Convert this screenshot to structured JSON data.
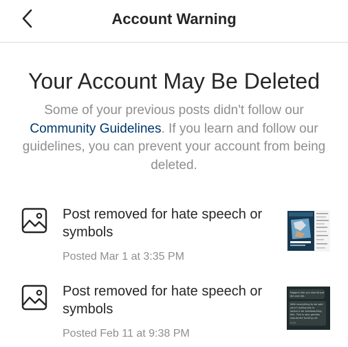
{
  "header": {
    "title": "Account Warning",
    "back_icon": "chevron-left-icon"
  },
  "warning": {
    "heading": "Your Account May Be Deleted",
    "description_before": "Some of your previous posts didn't follow our ",
    "guidelines_link": "Community Guidelines",
    "description_after": ". If you learn and follow our guidelines, you can prevent your account from being deleted."
  },
  "posts": [
    {
      "icon": "image-icon",
      "title": "Post removed for hate speech or symbols",
      "date": "Posted Mar 1 at 3:35 PM"
    },
    {
      "icon": "image-icon",
      "title": "Post removed for hate speech or symbols",
      "date": "Posted Feb 11 at 9:38 PM",
      "thumb_lines": [
        "Niggers like you should just",
        "die and die.",
        "With everything to be said",
        "your f-ucking ass in",
        "sector a for skindworking",
        "fish. This is why gentles",
        "should die fucking cut",
        "4:18"
      ]
    }
  ],
  "colors": {
    "text_primary": "#262626",
    "text_secondary": "#8e8e8e",
    "link": "#00376b",
    "divider": "#dbdbdb"
  }
}
